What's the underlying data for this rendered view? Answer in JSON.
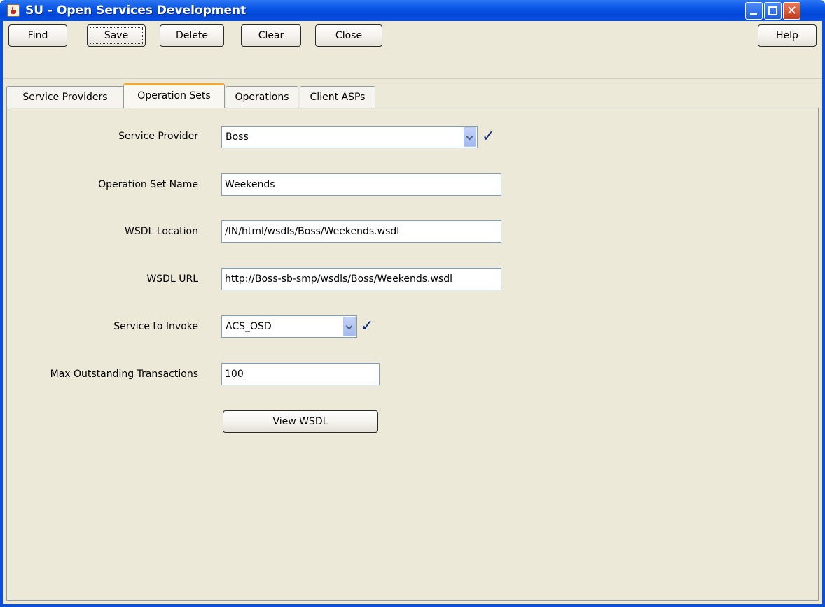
{
  "window": {
    "title": "SU - Open Services Development",
    "controls": [
      "minimize-icon",
      "maximize-icon",
      "close-icon"
    ]
  },
  "toolbar": {
    "find_label": "Find",
    "save_label": "Save",
    "delete_label": "Delete",
    "clear_label": "Clear",
    "close_label": "Close",
    "help_label": "Help"
  },
  "tabs": [
    {
      "label": "Service Providers",
      "active": false
    },
    {
      "label": "Operation Sets",
      "active": true
    },
    {
      "label": "Operations",
      "active": false
    },
    {
      "label": "Client ASPs",
      "active": false
    }
  ],
  "form": {
    "service_provider": {
      "label": "Service Provider",
      "value": "Boss",
      "check": "✓"
    },
    "operation_set_name": {
      "label": "Operation Set Name",
      "value": "Weekends"
    },
    "wsdl_location": {
      "label": "WSDL Location",
      "value": "/IN/html/wsdls/Boss/Weekends.wsdl"
    },
    "wsdl_url": {
      "label": "WSDL URL",
      "value": "http://Boss-sb-smp/wsdls/Boss/Weekends.wsdl"
    },
    "service_to_invoke": {
      "label": "Service to Invoke",
      "value": "ACS_OSD",
      "check": "✓"
    },
    "max_outstanding_transactions": {
      "label": "Max Outstanding Transactions",
      "value": "100"
    },
    "view_wsdl_label": "View WSDL"
  },
  "colors": {
    "titlebar": "#0a56e6",
    "window_bg": "#ece9d8",
    "active_tab_accent": "#f2a92c",
    "check": "#0a2680"
  }
}
